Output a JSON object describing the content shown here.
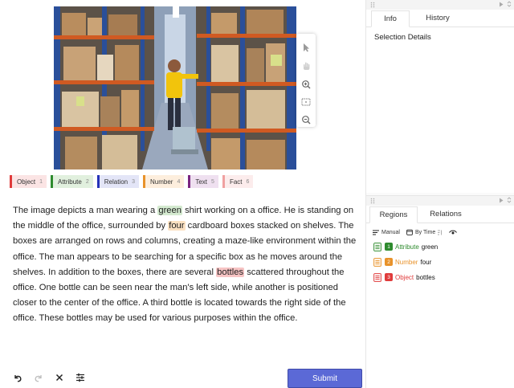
{
  "colors": {
    "object": "#e03b3b",
    "attribute": "#2e8b2e",
    "relation": "#2532b8",
    "number": "#e8922a",
    "text": "#7a2480",
    "fact": "#f0a0a0",
    "submit": "#5b69d6"
  },
  "labels": [
    {
      "name": "Object",
      "key": "1"
    },
    {
      "name": "Attribute",
      "key": "2"
    },
    {
      "name": "Relation",
      "key": "3"
    },
    {
      "name": "Number",
      "key": "4"
    },
    {
      "name": "Text",
      "key": "5"
    },
    {
      "name": "Fact",
      "key": "6"
    }
  ],
  "caption": {
    "p1": "The image depicts a man wearing a ",
    "h1": "green",
    "p2": " shirt working on a office. He is standing on the middle of the office, surrounded by ",
    "h2": "four",
    "p3": " cardboard boxes stacked on shelves. The boxes are arranged on rows and columns, creating a maze-like environment within the office. The man appears to be searching for a specific box as he moves around the shelves. In addition to the boxes, there are several ",
    "h3": "bottles",
    "p4": " scattered throughout the office. One bottle can be seen near the man's left side, while another is positioned closer to the center of the office. A third bottle is located towards the right side of the office. These bottles may be used for various purposes within the office."
  },
  "submit_label": "Submit",
  "info_panel": {
    "tabs": [
      "Info",
      "History"
    ],
    "heading": "Selection Details"
  },
  "regions_panel": {
    "tabs": [
      "Regions",
      "Relations"
    ],
    "sort_manual": "Manual",
    "sort_time": "By Time",
    "items": [
      {
        "index": "1",
        "category": "Attribute",
        "value": "green"
      },
      {
        "index": "2",
        "category": "Number",
        "value": "four"
      },
      {
        "index": "3",
        "category": "Object",
        "value": "bottles"
      }
    ]
  }
}
